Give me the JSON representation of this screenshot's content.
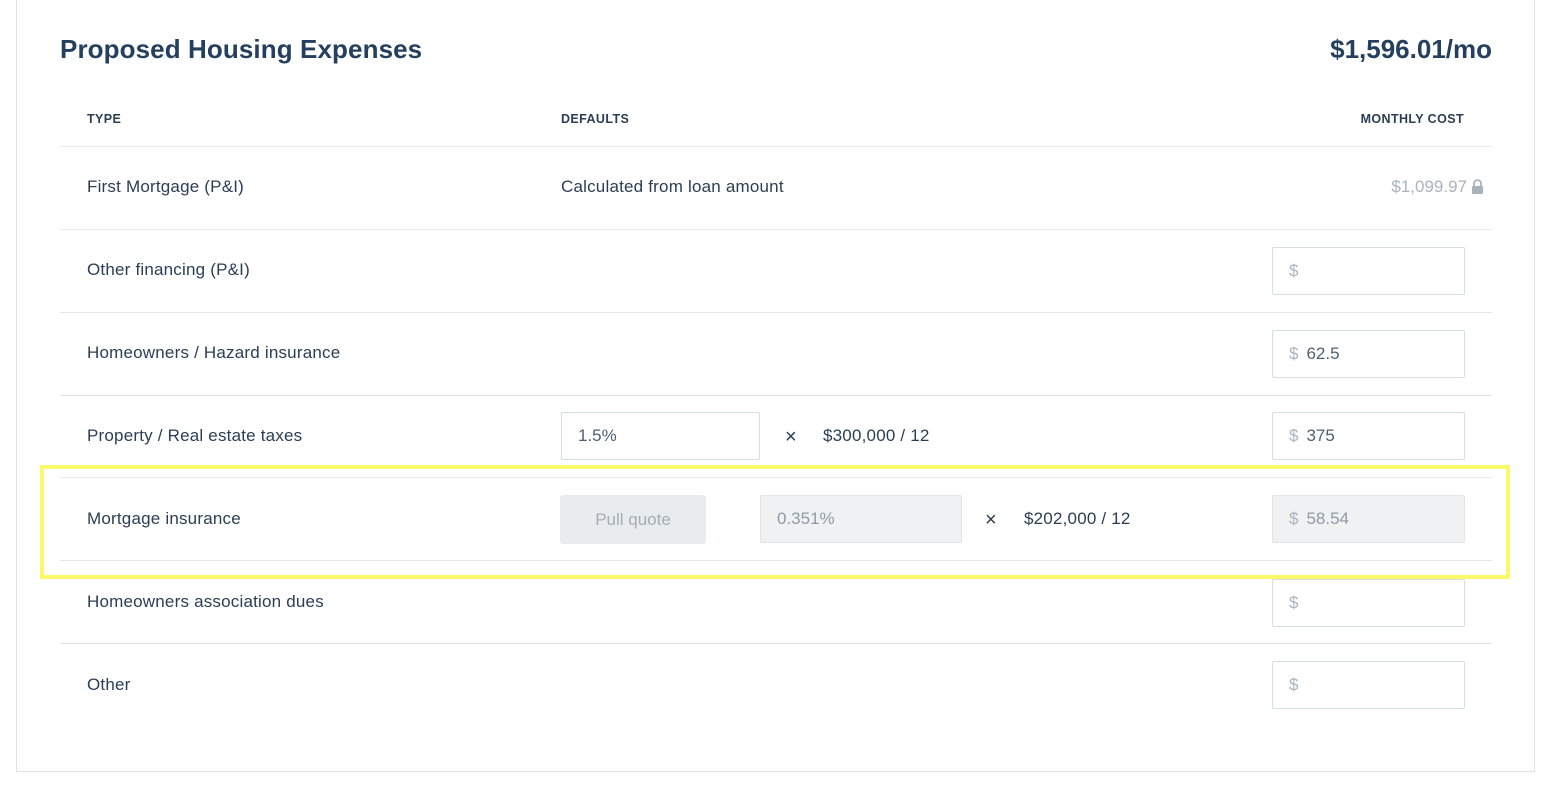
{
  "header": {
    "title": "Proposed Housing Expenses",
    "total": "$1,596.01/mo"
  },
  "columns": {
    "type": "TYPE",
    "defaults": "DEFAULTS",
    "monthly_cost": "MONTHLY COST"
  },
  "currency_symbol": "$",
  "times_symbol": "×",
  "rows": {
    "first_mortgage": {
      "label": "First Mortgage (P&I)",
      "default_text": "Calculated from loan amount",
      "monthly_cost": "$1,099.97",
      "locked": true
    },
    "other_financing": {
      "label": "Other financing (P&I)",
      "monthly_cost": ""
    },
    "hazard_insurance": {
      "label": "Homeowners / Hazard insurance",
      "monthly_cost": "62.5"
    },
    "property_taxes": {
      "label": "Property / Real estate taxes",
      "rate": "1.5%",
      "multiplier_text": "$300,000 / 12",
      "monthly_cost": "375"
    },
    "mortgage_insurance": {
      "label": "Mortgage insurance",
      "button_label": "Pull quote",
      "rate": "0.351%",
      "multiplier_text": "$202,000 / 12",
      "monthly_cost": "58.54",
      "disabled": true,
      "highlighted": true
    },
    "hoa_dues": {
      "label": "Homeowners association dues",
      "monthly_cost": ""
    },
    "other": {
      "label": "Other",
      "monthly_cost": ""
    }
  },
  "colors": {
    "title": "#24405e",
    "highlight": "#fbf86a",
    "disabled_bg": "#eff1f3"
  }
}
